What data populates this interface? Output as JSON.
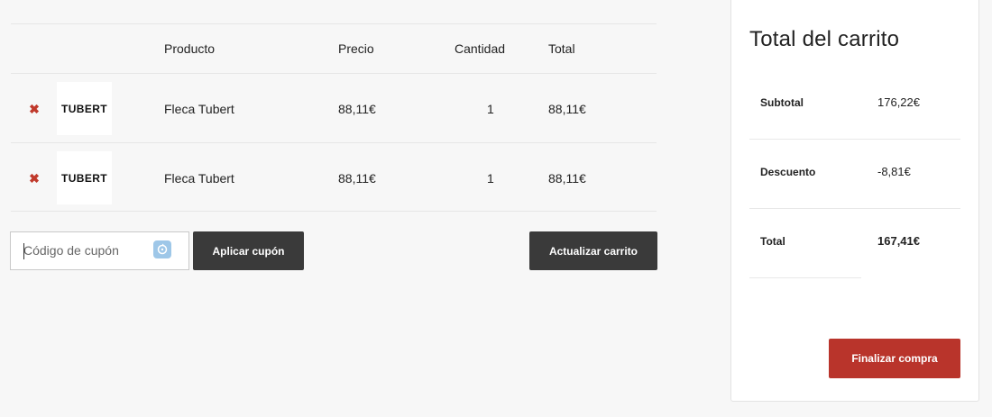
{
  "cart": {
    "columns": {
      "product": "Producto",
      "price": "Precio",
      "quantity": "Cantidad",
      "total": "Total"
    },
    "items": [
      {
        "remove_glyph": "✖",
        "thumb_text": "TUBERT",
        "product": "Fleca Tubert",
        "price": "88,11€",
        "quantity": "1",
        "total": "88,11€"
      },
      {
        "remove_glyph": "✖",
        "thumb_text": "TUBERT",
        "product": "Fleca Tubert",
        "price": "88,11€",
        "quantity": "1",
        "total": "88,11€"
      }
    ]
  },
  "coupon": {
    "placeholder": "Código de cupón",
    "apply_label": "Aplicar cupón",
    "icon": "coupon-refresh-icon"
  },
  "update_label": "Actualizar carrito",
  "totals": {
    "title": "Total del carrito",
    "rows": [
      {
        "label": "Subtotal",
        "value": "176,22€"
      },
      {
        "label": "Descuento",
        "value": "-8,81€"
      },
      {
        "label": "Total",
        "value": "167,41€"
      }
    ],
    "checkout_label": "Finalizar compra"
  },
  "colors": {
    "remove": "#c0392b",
    "button_dark": "#3a3a3a",
    "checkout": "#b9342b",
    "coupon_icon": "#9ec7e8"
  }
}
